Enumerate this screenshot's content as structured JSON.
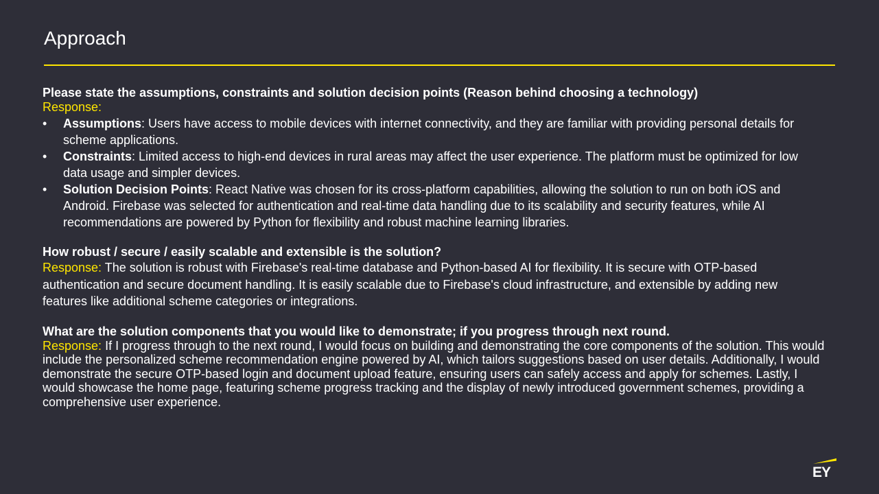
{
  "slide": {
    "title": "Approach"
  },
  "section1": {
    "question": "Please state the assumptions, constraints and solution decision points (Reason behind choosing a technology)",
    "response_label": "Response:",
    "bullets": [
      {
        "bullet": "•",
        "term": "Assumptions",
        "text": ": Users have access to mobile devices with internet connectivity, and they are familiar with providing personal details for scheme applications."
      },
      {
        "bullet": "•",
        "term": "Constraints",
        "text": ": Limited access to high-end devices in rural areas may affect the user experience. The platform must be optimized for low data usage and simpler devices."
      },
      {
        "bullet": "•",
        "term": "Solution Decision Points",
        "text": ": React Native was chosen for its cross-platform capabilities, allowing the solution to run on both iOS and Android. Firebase was selected for authentication and real-time data handling due to its scalability and security features, while AI recommendations are powered by Python for flexibility and robust machine learning libraries."
      }
    ]
  },
  "section2": {
    "question": "How robust / secure / easily scalable and extensible is the solution?",
    "response_label": "Response:",
    "response_text": " The solution is robust with Firebase's real-time database and Python-based AI for flexibility. It is secure with OTP-based authentication and secure document handling. It is easily scalable due to Firebase's cloud infrastructure, and extensible by adding new features like additional scheme categories or integrations."
  },
  "section3": {
    "question": "What are the solution components that you would like to demonstrate; if you progress through next round.",
    "response_label": "Response:",
    "response_text": " If I progress through to the next round, I would focus on building and demonstrating the core components of the solution. This would include the personalized scheme recommendation engine powered by AI, which tailors suggestions based on user details. Additionally, I would demonstrate the secure OTP-based login and document upload feature, ensuring users can safely access and apply for schemes. Lastly, I would showcase the home page, featuring scheme progress tracking and the display of newly introduced government schemes, providing a comprehensive user experience."
  },
  "logo": {
    "text": "EY",
    "accent_color": "#ffe600"
  },
  "colors": {
    "background": "#2e2e38",
    "accent": "#ffe600",
    "text": "#ffffff"
  }
}
